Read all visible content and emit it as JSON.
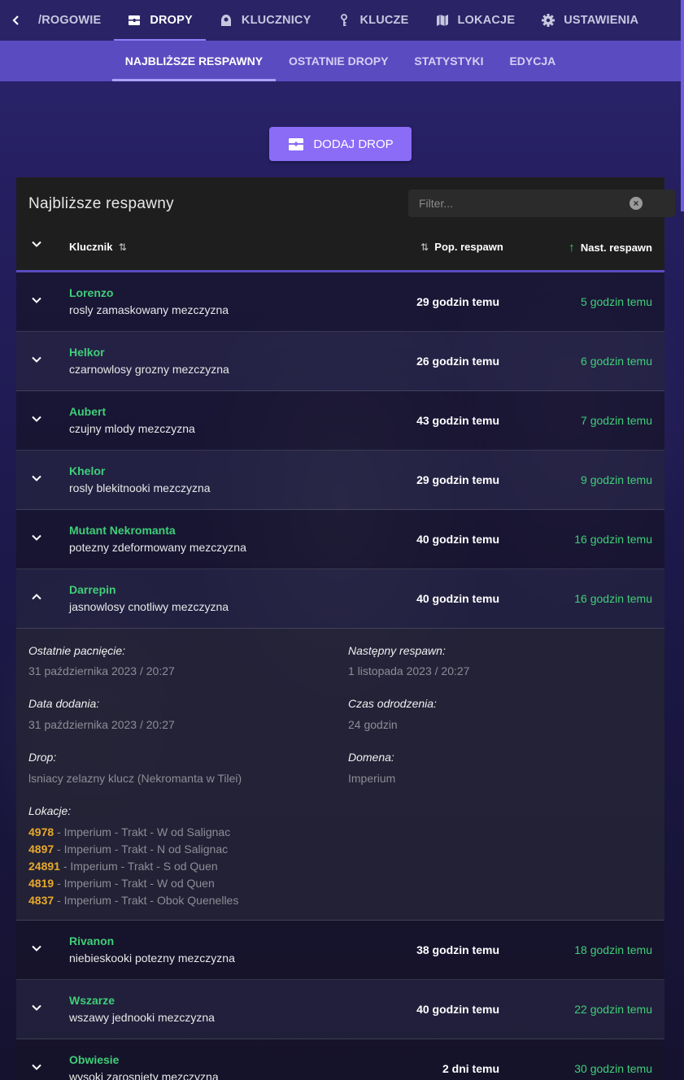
{
  "nav": {
    "back_label": "/ROGOWIE",
    "tabs": [
      {
        "label": "DROPY",
        "icon": "treasure-chest-icon",
        "active": true
      },
      {
        "label": "KLUCZNICY",
        "icon": "hooded-figure-icon",
        "active": false
      },
      {
        "label": "KLUCZE",
        "icon": "keys-icon",
        "active": false
      },
      {
        "label": "LOKACJE",
        "icon": "map-icon",
        "active": false
      },
      {
        "label": "USTAWIENIA",
        "icon": "gear-icon",
        "active": false
      }
    ]
  },
  "subnav": {
    "tabs": [
      {
        "label": "NAJBLIŻSZE RESPAWNY",
        "active": true
      },
      {
        "label": "OSTATNIE DROPY",
        "active": false
      },
      {
        "label": "STATYSTYKI",
        "active": false
      },
      {
        "label": "EDYCJA",
        "active": false
      }
    ]
  },
  "add_button": {
    "label": "DODAJ DROP",
    "icon": "treasure-chest-icon"
  },
  "table": {
    "title": "Najbliższe respawny",
    "filter_placeholder": "Filter...",
    "columns": {
      "kluchnik": "Klucznik",
      "prev": "Pop. respawn",
      "next": "Nast. respawn"
    },
    "sort": {
      "kluchnik": "⇅",
      "prev": "⇅",
      "next": "↑"
    },
    "rows": [
      {
        "name": "Lorenzo",
        "desc": "rosly zamaskowany mezczyzna",
        "prev": "29 godzin temu",
        "next": "5 godzin temu",
        "expanded": false
      },
      {
        "name": "Helkor",
        "desc": "czarnowlosy grozny mezczyzna",
        "prev": "26 godzin temu",
        "next": "6 godzin temu",
        "expanded": false
      },
      {
        "name": "Aubert",
        "desc": "czujny mlody mezczyzna",
        "prev": "43 godzin temu",
        "next": "7 godzin temu",
        "expanded": false
      },
      {
        "name": "Khelor",
        "desc": "rosly blekitnooki mezczyzna",
        "prev": "29 godzin temu",
        "next": "9 godzin temu",
        "expanded": false
      },
      {
        "name": "Mutant Nekromanta",
        "desc": "potezny zdeformowany mezczyzna",
        "prev": "40 godzin temu",
        "next": "16 godzin temu",
        "expanded": false
      },
      {
        "name": "Darrepin",
        "desc": "jasnowlosy cnotliwy mezczyzna",
        "prev": "40 godzin temu",
        "next": "16 godzin temu",
        "expanded": true
      },
      {
        "name": "Rivanon",
        "desc": "niebieskooki potezny mezczyzna",
        "prev": "38 godzin temu",
        "next": "18 godzin temu",
        "expanded": false
      },
      {
        "name": "Wszarze",
        "desc": "wszawy jednooki mezczyzna",
        "prev": "40 godzin temu",
        "next": "22 godzin temu",
        "expanded": false
      },
      {
        "name": "Obwiesie",
        "desc": "wysoki zarosniety mezczyzna",
        "prev": "2 dni temu",
        "next": "30 godzin temu",
        "expanded": false
      }
    ],
    "details": {
      "last_kill_label": "Ostatnie pacnięcie:",
      "last_kill_value": "31 października 2023 / 20:27",
      "next_respawn_label": "Następny respawn:",
      "next_respawn_value": "1 listopada 2023 / 20:27",
      "added_label": "Data dodania:",
      "added_value": "31 października 2023 / 20:27",
      "respawn_time_label": "Czas odrodzenia:",
      "respawn_time_value": "24 godzin",
      "drop_label": "Drop:",
      "drop_value": "lsniacy zelazny klucz (Nekromanta w Tilei)",
      "domain_label": "Domena:",
      "domain_value": "Imperium",
      "locations_label": "Lokacje:",
      "locations": [
        {
          "id": "4978",
          "text": " - Imperium - Trakt - W od Salignac"
        },
        {
          "id": "4897",
          "text": " - Imperium - Trakt - N od Salignac"
        },
        {
          "id": "24891",
          "text": " - Imperium - Trakt - S od Quen"
        },
        {
          "id": "4819",
          "text": " - Imperium - Trakt - W od Quen"
        },
        {
          "id": "4837",
          "text": " - Imperium - Trakt - Obok Quenelles"
        }
      ]
    }
  },
  "colors": {
    "accent": "#8a6cf7",
    "subnav": "#5b4bc0",
    "topnav": "#2a2466",
    "green": "#3fcf78",
    "location_id": "#e7a92c"
  }
}
